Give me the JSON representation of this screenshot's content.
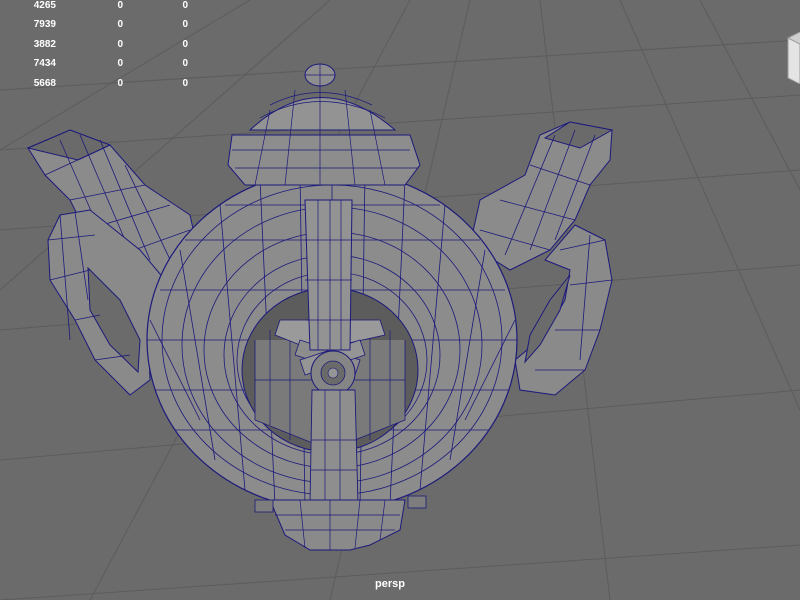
{
  "viewport": {
    "camera_label": "persp"
  },
  "hud": {
    "rows": [
      [
        "4265",
        "0",
        "0"
      ],
      [
        "7939",
        "0",
        "0"
      ],
      [
        "3882",
        "0",
        "0"
      ],
      [
        "7434",
        "0",
        "0"
      ],
      [
        "5668",
        "0",
        "0"
      ]
    ]
  },
  "colors": {
    "background": "#6b6b6b",
    "grid_line": "#5a5a5a",
    "mesh_fill": "#8a8a8a",
    "mesh_shade": "#5f5f5f",
    "wireframe": "#1c1a7a",
    "hud_text": "#ffffff"
  },
  "icons": {
    "view_cube": "view-cube-icon"
  }
}
